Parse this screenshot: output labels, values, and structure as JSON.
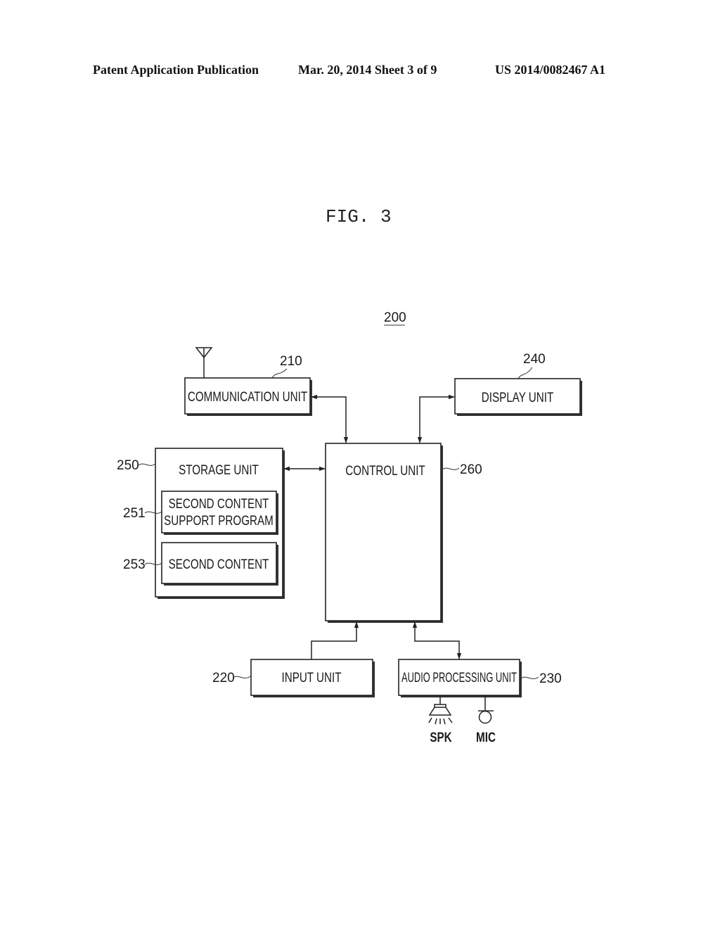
{
  "header": {
    "publication": "Patent Application Publication",
    "date_sheet": "Mar. 20, 2014  Sheet 3 of 9",
    "patent_number": "US 2014/0082467 A1"
  },
  "figure": {
    "title": "FIG. 3",
    "device_ref": "200"
  },
  "blocks": {
    "communication": {
      "label": "COMMUNICATION UNIT",
      "ref": "210"
    },
    "display": {
      "label": "DISPLAY UNIT",
      "ref": "240"
    },
    "storage": {
      "label": "STORAGE UNIT",
      "ref": "250"
    },
    "support_program": {
      "label_line1": "SECOND CONTENT",
      "label_line2": "SUPPORT PROGRAM",
      "ref": "251"
    },
    "second_content": {
      "label": "SECOND CONTENT",
      "ref": "253"
    },
    "control": {
      "label": "CONTROL UNIT",
      "ref": "260"
    },
    "input": {
      "label": "INPUT UNIT",
      "ref": "220"
    },
    "audio": {
      "label": "AUDIO PROCESSING UNIT",
      "ref": "230"
    }
  },
  "peripherals": {
    "speaker": "SPK",
    "microphone": "MIC"
  }
}
